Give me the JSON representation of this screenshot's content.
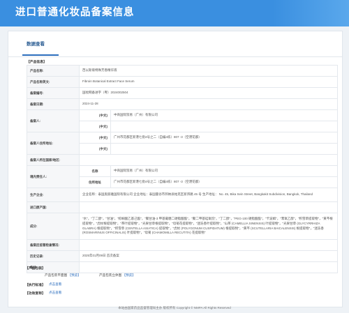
{
  "header": {
    "title": "进口普通化妆品备案信息"
  },
  "tabs": [
    {
      "label": "数据查看"
    }
  ],
  "product_info": {
    "section_title": "【产品信息】",
    "rows": {
      "name_label": "产品名称:",
      "name_value": "芭以斯菊特殊芳香精华液",
      "name_en_label": "产品名称英文:",
      "name_en_value": "Fibroin Botanical Extract Face Serum",
      "record_no_label": "备案编号:",
      "record_no_value": "国妆网备进字（粤）2024002504",
      "record_date_label": "备案日期:",
      "record_date_value": "2024-11-28",
      "filer_label": "备案人:",
      "filer_cn_sub": "(中文)",
      "filer_cn_value": "中商国际贸易（广州）有限公司",
      "filer_en_sub": "(中文)",
      "filer_addr_label": "备案人住所地址:",
      "filer_addr_cn_sub": "(中文)",
      "filer_addr_cn_value": "广州市花都区新港七街4号之二（自编4栋）807 -3（空港花都）",
      "filer_addr_en_sub": "(中文)",
      "origin_label": "备案人所在国家/地区:",
      "agent_label": "境内责任人:",
      "agent_name_sub": "名称",
      "agent_name_value": "中商国际贸易（广州）有限公司",
      "agent_addr_sub": "住所地址",
      "agent_addr_value": "广州市花都区新港七街4号之二（自编4栋）807 -3（空港花都）",
      "maker_label": "生产企业:",
      "maker_value": "企业名称：泰国奥丽雅国际有限公司 企业地址：泰国曼谷市邦纳县帕克区新邦路 45 号 生产地址： No. 45, Bika Sein Street, Bangkakit Subdivision, Bangkok, Thailand",
      "import_origin_label": "进口原产国:",
      "ingredients_label": "成分:",
      "ingredients_value": "\"水\"，\"丁二醇\"，\"甘油\"，\"棕榈酸乙基己酯\"，\"聚甘油-3 甲基葡糖二硬脂酸酯\"，\"聚二甲基硅氧烷\"，\"丁二醇\"，\"PEG-100 硬脂酸酯\"，\"卡波姆\"，\"苯氧乙醇\"，\"积雪草提取物\"，\"黄芩根提取物\"，\"虎杖根提取物\"，\"茶叶提取物\"，\"光果甘草根提取物\"，\"母菊花提取物\"，\"迷迭香叶提取物\"，\"山茶 (CAMELLIA SINENSIS) 叶提取物\"，\"光果甘草 (GLYCYRRHIZA GLABRA) 根提取物\"，\"积雪草 (CENTELLA ASIATICA) 提取物\"，\"虎杖 (POLYGONUM CUSPIDATUM) 根提取物\"，\"黄芩 (SCUTELLARIA BAICALENSIS) 根提取物\"，\"迷迭香 (ROSMARINUS OFFICINALIS) 叶提取物\"，\"母菊 (CHAMOMILLA RECUTITA) 花提取物\"",
      "post_check_label": "备案后监管检查情况:",
      "history_label": "历史记录:",
      "history_value": "2025年01月09日 首次备案",
      "remark_label": "备注:"
    }
  },
  "product_images": {
    "section_title": "【产品包装】",
    "plane_label": "产品包装平面图",
    "plane_link": "【预览】",
    "solid_label": "产品包装立体图",
    "solid_link": "【预览】"
  },
  "exec_standard": {
    "section_title": "【执行标准】",
    "link": "点击查看"
  },
  "efficacy": {
    "section_title": "【功效宣称】",
    "link": "点击查看"
  },
  "footer": {
    "text": "本站由国家药品监督管理局主办 版权所有 Copyright © NMPA All Rights Reserved"
  }
}
